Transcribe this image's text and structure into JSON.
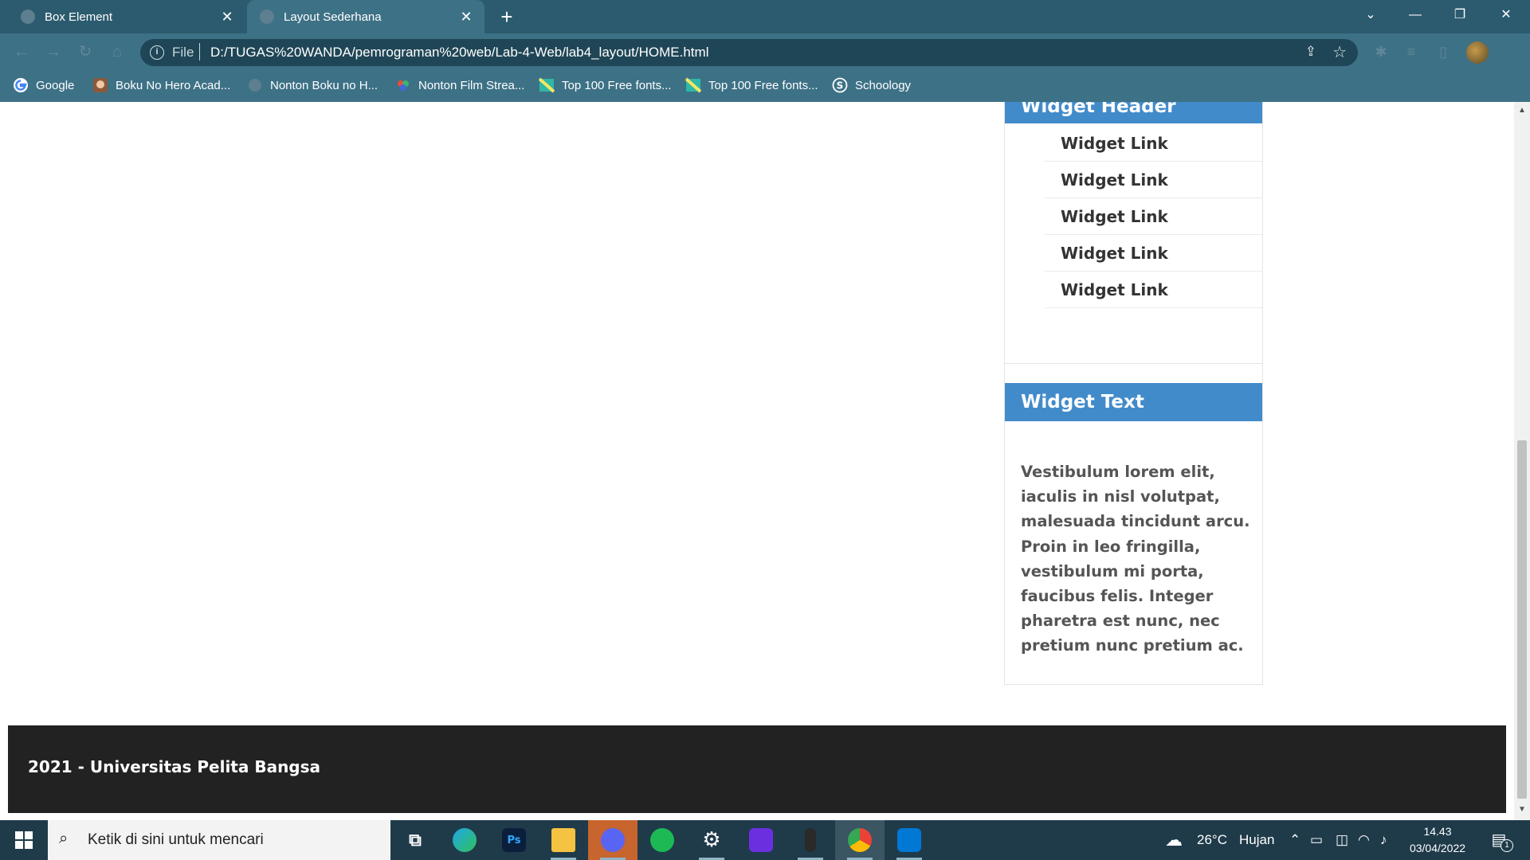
{
  "browser": {
    "tabs": [
      {
        "label": "Box Element",
        "active": false
      },
      {
        "label": "Layout Sederhana",
        "active": true
      }
    ],
    "close_glyph": "✕",
    "new_tab_glyph": "+",
    "window": {
      "minimize": "—",
      "restore": "❐",
      "close": "✕",
      "tab_search": "⌄"
    },
    "address": {
      "scheme": "File",
      "separator": "|",
      "url": "D:/TUGAS%20WANDA/pemrograman%20web/Lab-4-Web/lab4_layout/HOME.html"
    },
    "bookmarks": [
      {
        "label": "Google",
        "icon": "google-icon"
      },
      {
        "label": "Boku No Hero Acad...",
        "icon": "anime-icon"
      },
      {
        "label": "Nonton Boku no H...",
        "icon": "globe-icon"
      },
      {
        "label": "Nonton Film Strea...",
        "icon": "film-icon"
      },
      {
        "label": "Top 100 Free fonts...",
        "icon": "fonts-icon"
      },
      {
        "label": "Top 100 Free fonts...",
        "icon": "fonts-icon"
      },
      {
        "label": "Schoology",
        "icon": "schoology-icon"
      }
    ]
  },
  "page": {
    "widget_header": {
      "title": "Widget Header",
      "links": [
        "Widget Link",
        "Widget Link",
        "Widget Link",
        "Widget Link",
        "Widget Link"
      ]
    },
    "widget_text": {
      "title": "Widget Text",
      "body": "Vestibulum lorem elit, iaculis in nisl volutpat, malesuada tincidunt arcu. Proin in leo fringilla, vestibulum mi porta, faucibus felis. Integer pharetra est nunc, nec pretium nunc pretium ac."
    },
    "footer": {
      "text": "2021 - Universitas Pelita Bangsa"
    },
    "colors": {
      "widget_accent": "#428bca",
      "footer_bg": "#222222"
    }
  },
  "taskbar": {
    "search_placeholder": "Ketik di sini untuk mencari",
    "apps": [
      "task-view",
      "edge",
      "photoshop",
      "file-explorer",
      "discord",
      "spotify",
      "settings",
      "app-purple",
      "app-dark",
      "chrome",
      "vscode"
    ],
    "photoshop_label": "Ps",
    "weather": {
      "temp": "26°C",
      "condition": "Hujan"
    },
    "clock": {
      "time": "14.43",
      "date": "03/04/2022"
    },
    "notification_count": "1"
  }
}
